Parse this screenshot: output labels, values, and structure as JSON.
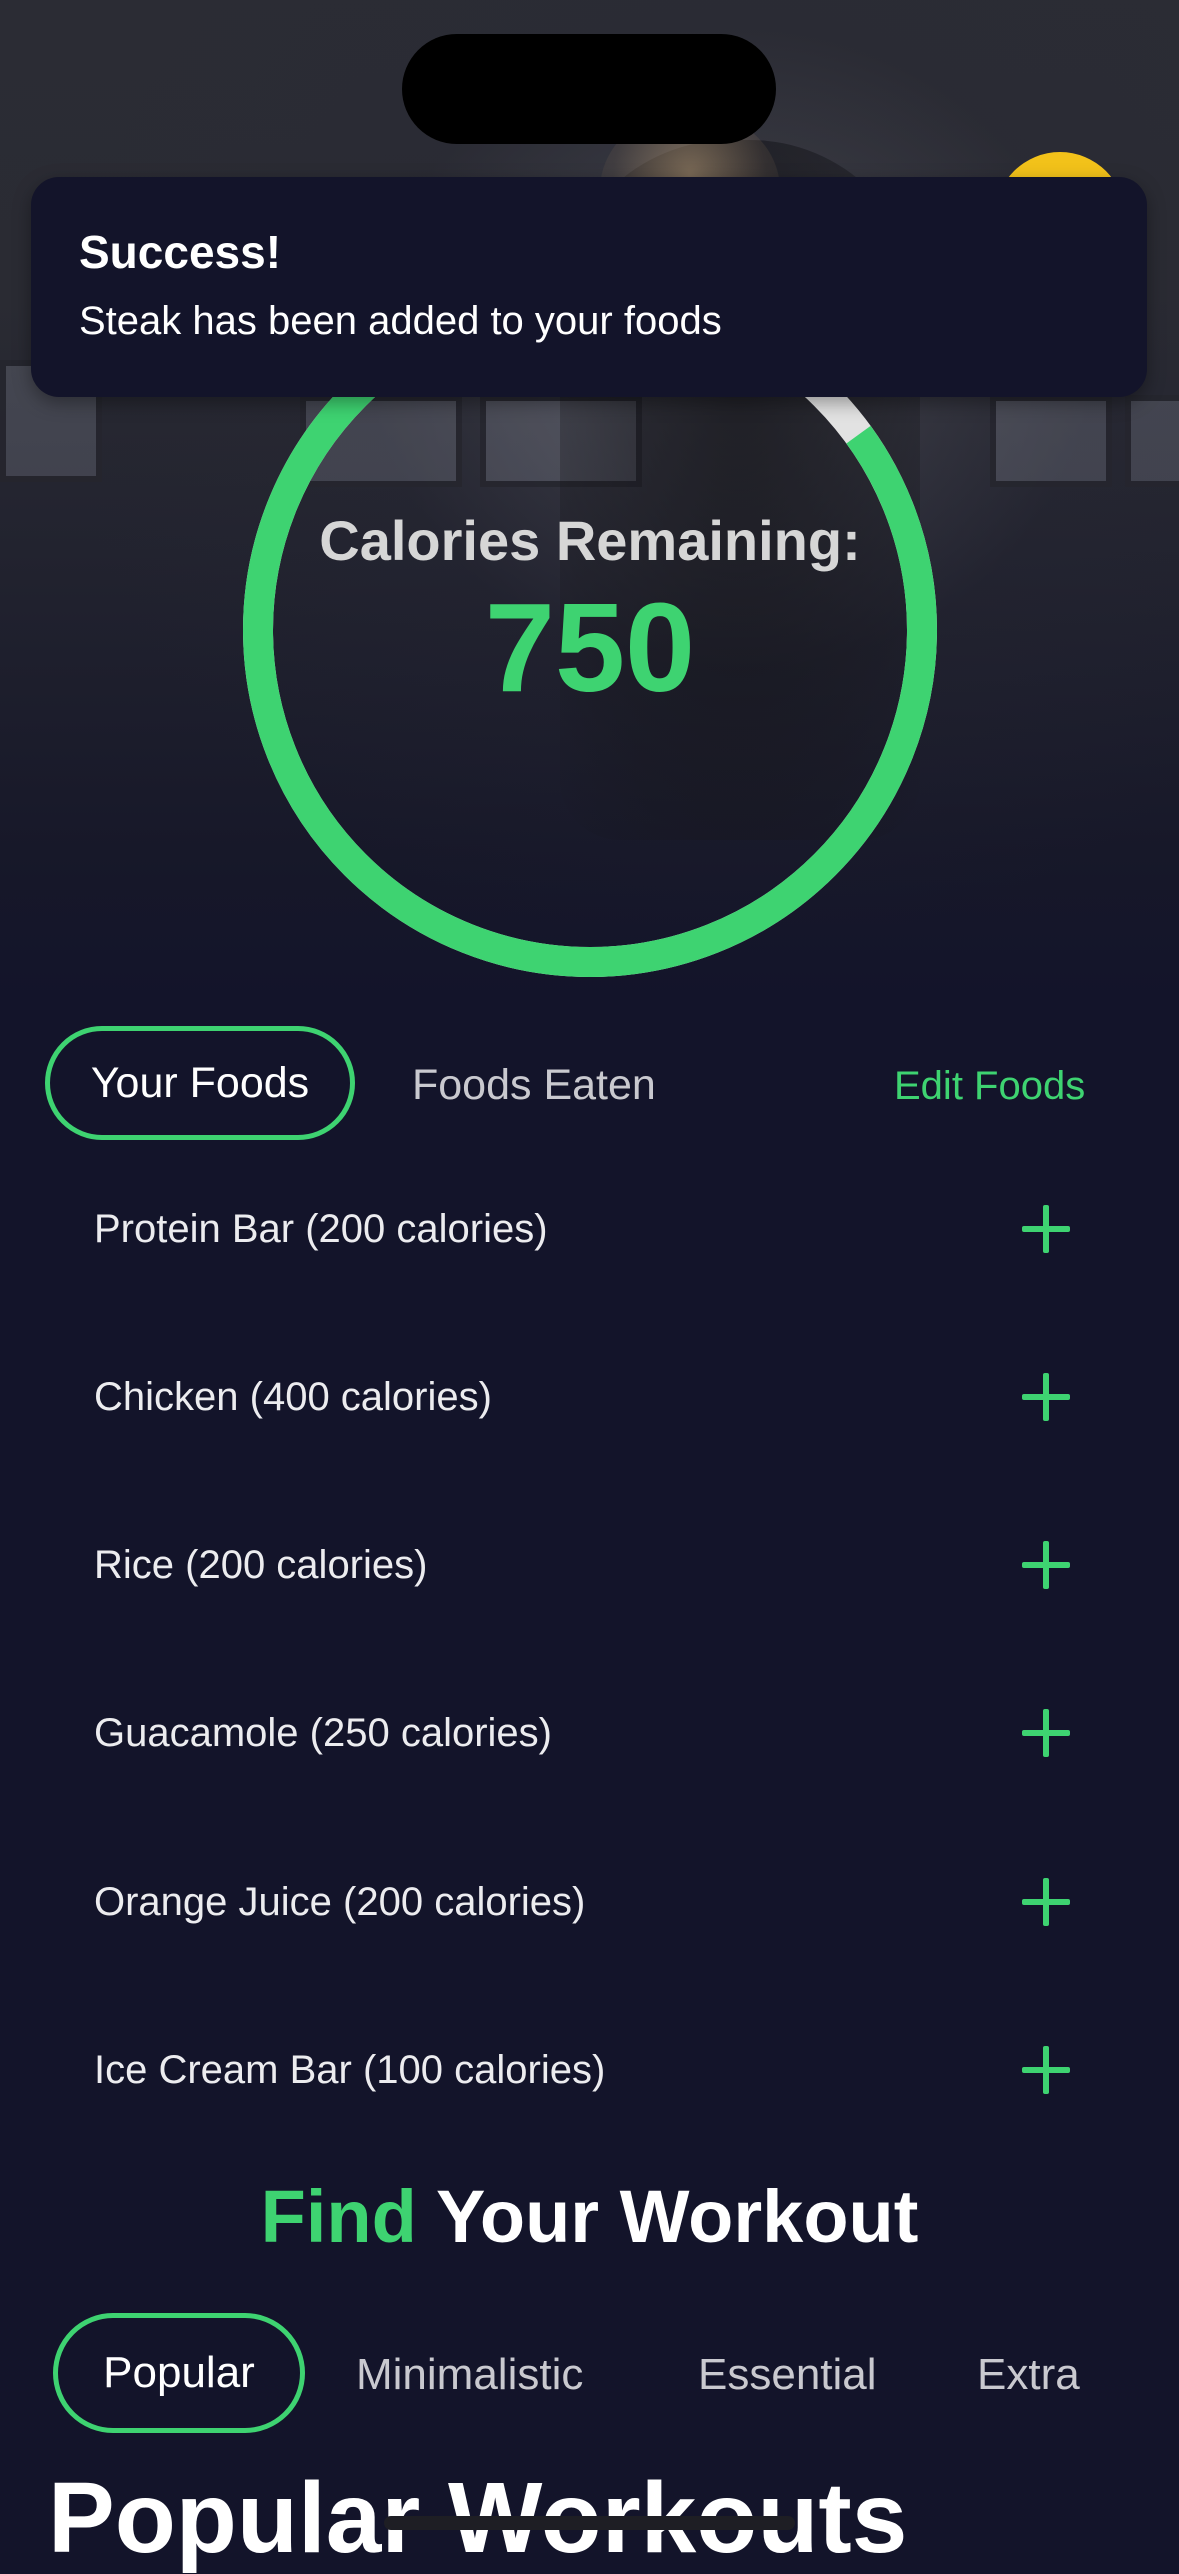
{
  "toast": {
    "title": "Success!",
    "message": "Steak has been added to your foods"
  },
  "calories": {
    "label": "Calories Remaining:",
    "value": "750",
    "progress_fraction": 0.85
  },
  "food_tabs": {
    "active": "Your Foods",
    "other": "Foods Eaten",
    "edit": "Edit Foods"
  },
  "foods": [
    {
      "name": "Protein Bar (200 calories)"
    },
    {
      "name": "Chicken (400 calories)"
    },
    {
      "name": "Rice (200 calories)"
    },
    {
      "name": "Guacamole (250 calories)"
    },
    {
      "name": "Orange Juice (200 calories)"
    },
    {
      "name": "Ice Cream Bar (100 calories)"
    }
  ],
  "workout": {
    "title_accent": "Find",
    "title_rest": "Your Workout",
    "tabs": [
      "Popular",
      "Minimalistic",
      "Essential",
      "Extra"
    ],
    "section_heading": "Popular Workouts"
  },
  "colors": {
    "accent": "#3ed371",
    "background": "#13142a",
    "ring_track": "#e2e2e2"
  },
  "icons": {
    "add": "plus-icon"
  }
}
